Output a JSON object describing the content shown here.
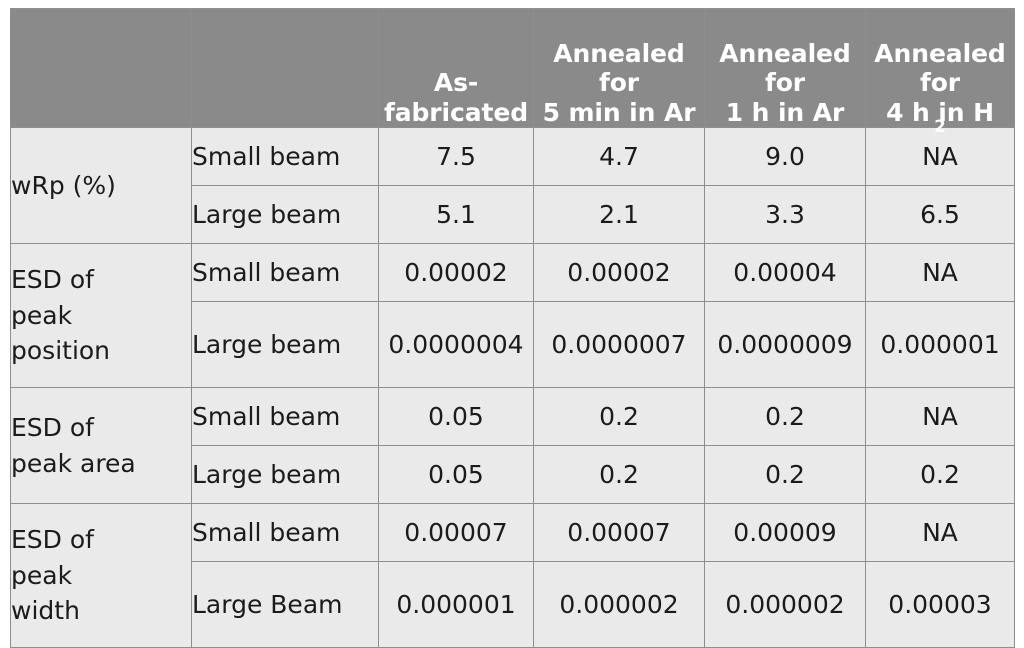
{
  "table": {
    "columns": [
      {
        "id": "row-group",
        "label": ""
      },
      {
        "id": "beam",
        "label": ""
      },
      {
        "id": "as-fabricated",
        "lines": [
          "As-",
          "fabricated"
        ]
      },
      {
        "id": "annealed-5min-ar",
        "lines": [
          "Annealed",
          "for",
          "5 min in Ar"
        ]
      },
      {
        "id": "annealed-1h-ar",
        "lines": [
          "Annealed",
          "for",
          "1 h in Ar"
        ]
      },
      {
        "id": "annealed-4h-h2",
        "lines": [
          "Annealed",
          "for",
          "4 h in H"
        ],
        "subscript": "2"
      }
    ],
    "groups": [
      {
        "label_lines": [
          "wRp (%)"
        ],
        "rows": [
          {
            "beam": "Small beam",
            "values": [
              "7.5",
              "4.7",
              "9.0",
              "NA"
            ]
          },
          {
            "beam": "Large beam",
            "values": [
              "5.1",
              "2.1",
              "3.3",
              "6.5"
            ]
          }
        ]
      },
      {
        "label_lines": [
          "ESD of",
          "peak",
          "position"
        ],
        "rows": [
          {
            "beam": "Small beam",
            "values": [
              "0.00002",
              "0.00002",
              "0.00004",
              "NA"
            ]
          },
          {
            "beam": "Large beam",
            "values": [
              "0.0000004",
              "0.0000007",
              "0.0000009",
              "0.000001"
            ]
          }
        ]
      },
      {
        "label_lines": [
          "ESD of",
          "peak area"
        ],
        "rows": [
          {
            "beam": "Small beam",
            "values": [
              "0.05",
              "0.2",
              "0.2",
              "NA"
            ]
          },
          {
            "beam": "Large beam",
            "values": [
              "0.05",
              "0.2",
              "0.2",
              "0.2"
            ]
          }
        ]
      },
      {
        "label_lines": [
          "ESD of",
          "peak",
          "width"
        ],
        "rows": [
          {
            "beam": "Small beam",
            "values": [
              "0.00007",
              "0.00007",
              "0.00009",
              "NA"
            ]
          },
          {
            "beam": "Large Beam",
            "values": [
              "0.000001",
              "0.000002",
              "0.000002",
              "0.00003"
            ]
          }
        ]
      }
    ],
    "colors": {
      "header_background": "#8a8a8a",
      "header_text": "#ffffff",
      "body_background": "#eaeaea",
      "body_text": "#1b1b1b",
      "grid_line": "#8e8e8e"
    }
  }
}
